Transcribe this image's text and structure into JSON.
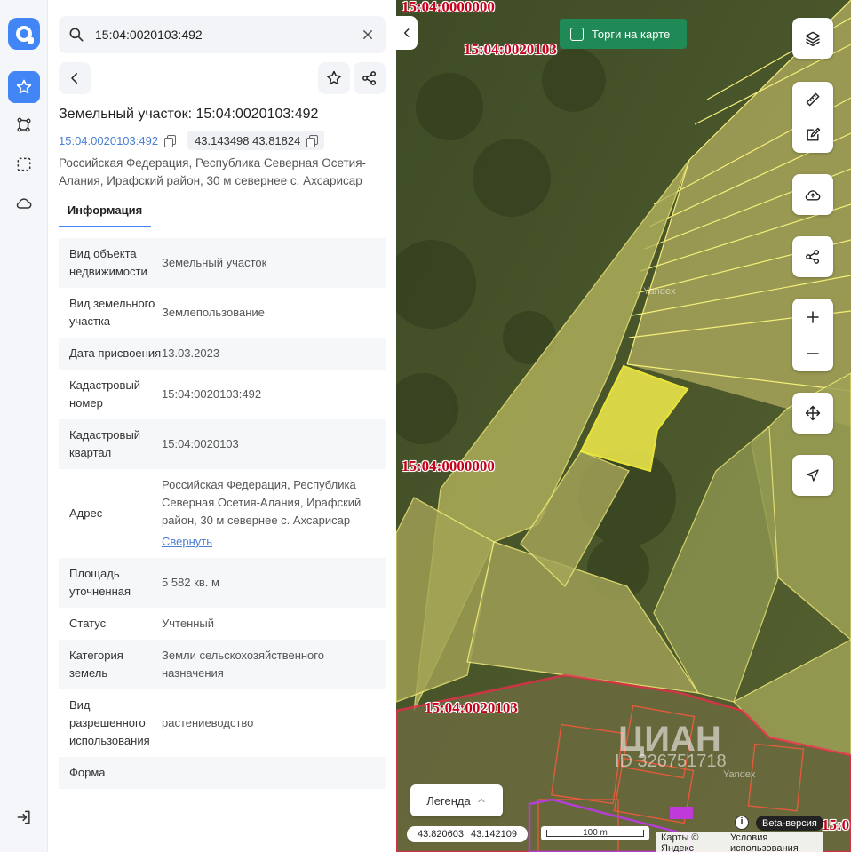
{
  "search": {
    "value": "15:04:0020103:492"
  },
  "parcel": {
    "title": "Земельный участок: 15:04:0020103:492",
    "cad_number": "15:04:0020103:492",
    "coords": "43.143498 43.81824",
    "address": "Российская Федерация, Республика Северная Осетия-Алания, Ирафский район, 30 м севернее с. Ахсарисар"
  },
  "tabs": {
    "info": "Информация"
  },
  "props": [
    {
      "key": "Вид объекта недвижимости",
      "value": "Земельный участок"
    },
    {
      "key": "Вид земельного участка",
      "value": "Землепользование"
    },
    {
      "key": "Дата присвоения",
      "value": "13.03.2023"
    },
    {
      "key": "Кадастровый номер",
      "value": "15:04:0020103:492"
    },
    {
      "key": "Кадастровый квартал",
      "value": "15:04:0020103"
    },
    {
      "key": "Адрес",
      "value": "Российская Федерация, Республика Северная Осетия-Алания, Ирафский район, 30 м севернее с. Ахсарисар",
      "link": "Свернуть"
    },
    {
      "key": "Площадь уточненная",
      "value": "5 582 кв. м"
    },
    {
      "key": "Статус",
      "value": "Учтенный"
    },
    {
      "key": "Категория земель",
      "value": "Земли сельскохозяйственного назначения"
    },
    {
      "key": "Вид разрешенного использования",
      "value": "растениеводство"
    },
    {
      "key": "Форма",
      "value": ""
    }
  ],
  "map": {
    "torgi_label": "Торги на карте",
    "labels": {
      "top": "15:04:0000000",
      "top_quarter": "15:04:0020103",
      "mid": "15:04:0000000",
      "bottom": "15:04:0020103",
      "edge": "15:0"
    },
    "legend_label": "Легенда",
    "cursor_lon": "43.820603",
    "cursor_lat": "43.142109",
    "scale_label": "100 m",
    "beta_label": "Beta-версия",
    "info_glyph": "i",
    "yandex_maps": "Карты © Яндекс",
    "terms": "Условия использования",
    "watermark_yandex": "Yandex",
    "watermark_cian": "ЦИАН",
    "watermark_id": "ID 326751718"
  },
  "colors": {
    "accent": "#4285f4",
    "torgi": "#1f8a55",
    "parcel_fill": "#e8e34a",
    "map_label": "#c4001a"
  }
}
